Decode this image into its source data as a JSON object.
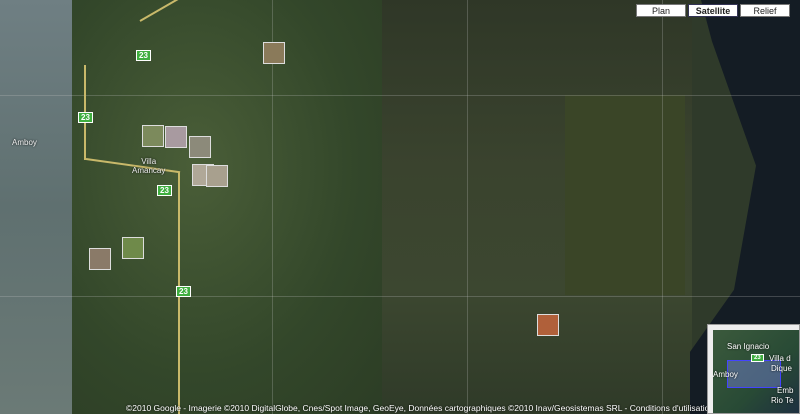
{
  "map_types": [
    {
      "label": "Plan",
      "active": false
    },
    {
      "label": "Satellite",
      "active": true
    },
    {
      "label": "Relief",
      "active": false
    }
  ],
  "labels": {
    "amboy": "Amboy",
    "villa_line1": "Villa",
    "villa_line2": "Amancay"
  },
  "route": "23",
  "copyright": "©2010 Google - Imagerie ©2010 DigitalGlobe, Cnes/Spot Image, GeoEye, Données cartographiques ©2010 Inav/Geosistemas SRL - Conditions d'utilisation",
  "overview": {
    "san_ignacio": "San Ignacio",
    "amboy": "Amboy",
    "villa": "Villa d",
    "dique": "Dique",
    "embalse": "Emb",
    "rio": "Rio Te",
    "route": "23"
  }
}
